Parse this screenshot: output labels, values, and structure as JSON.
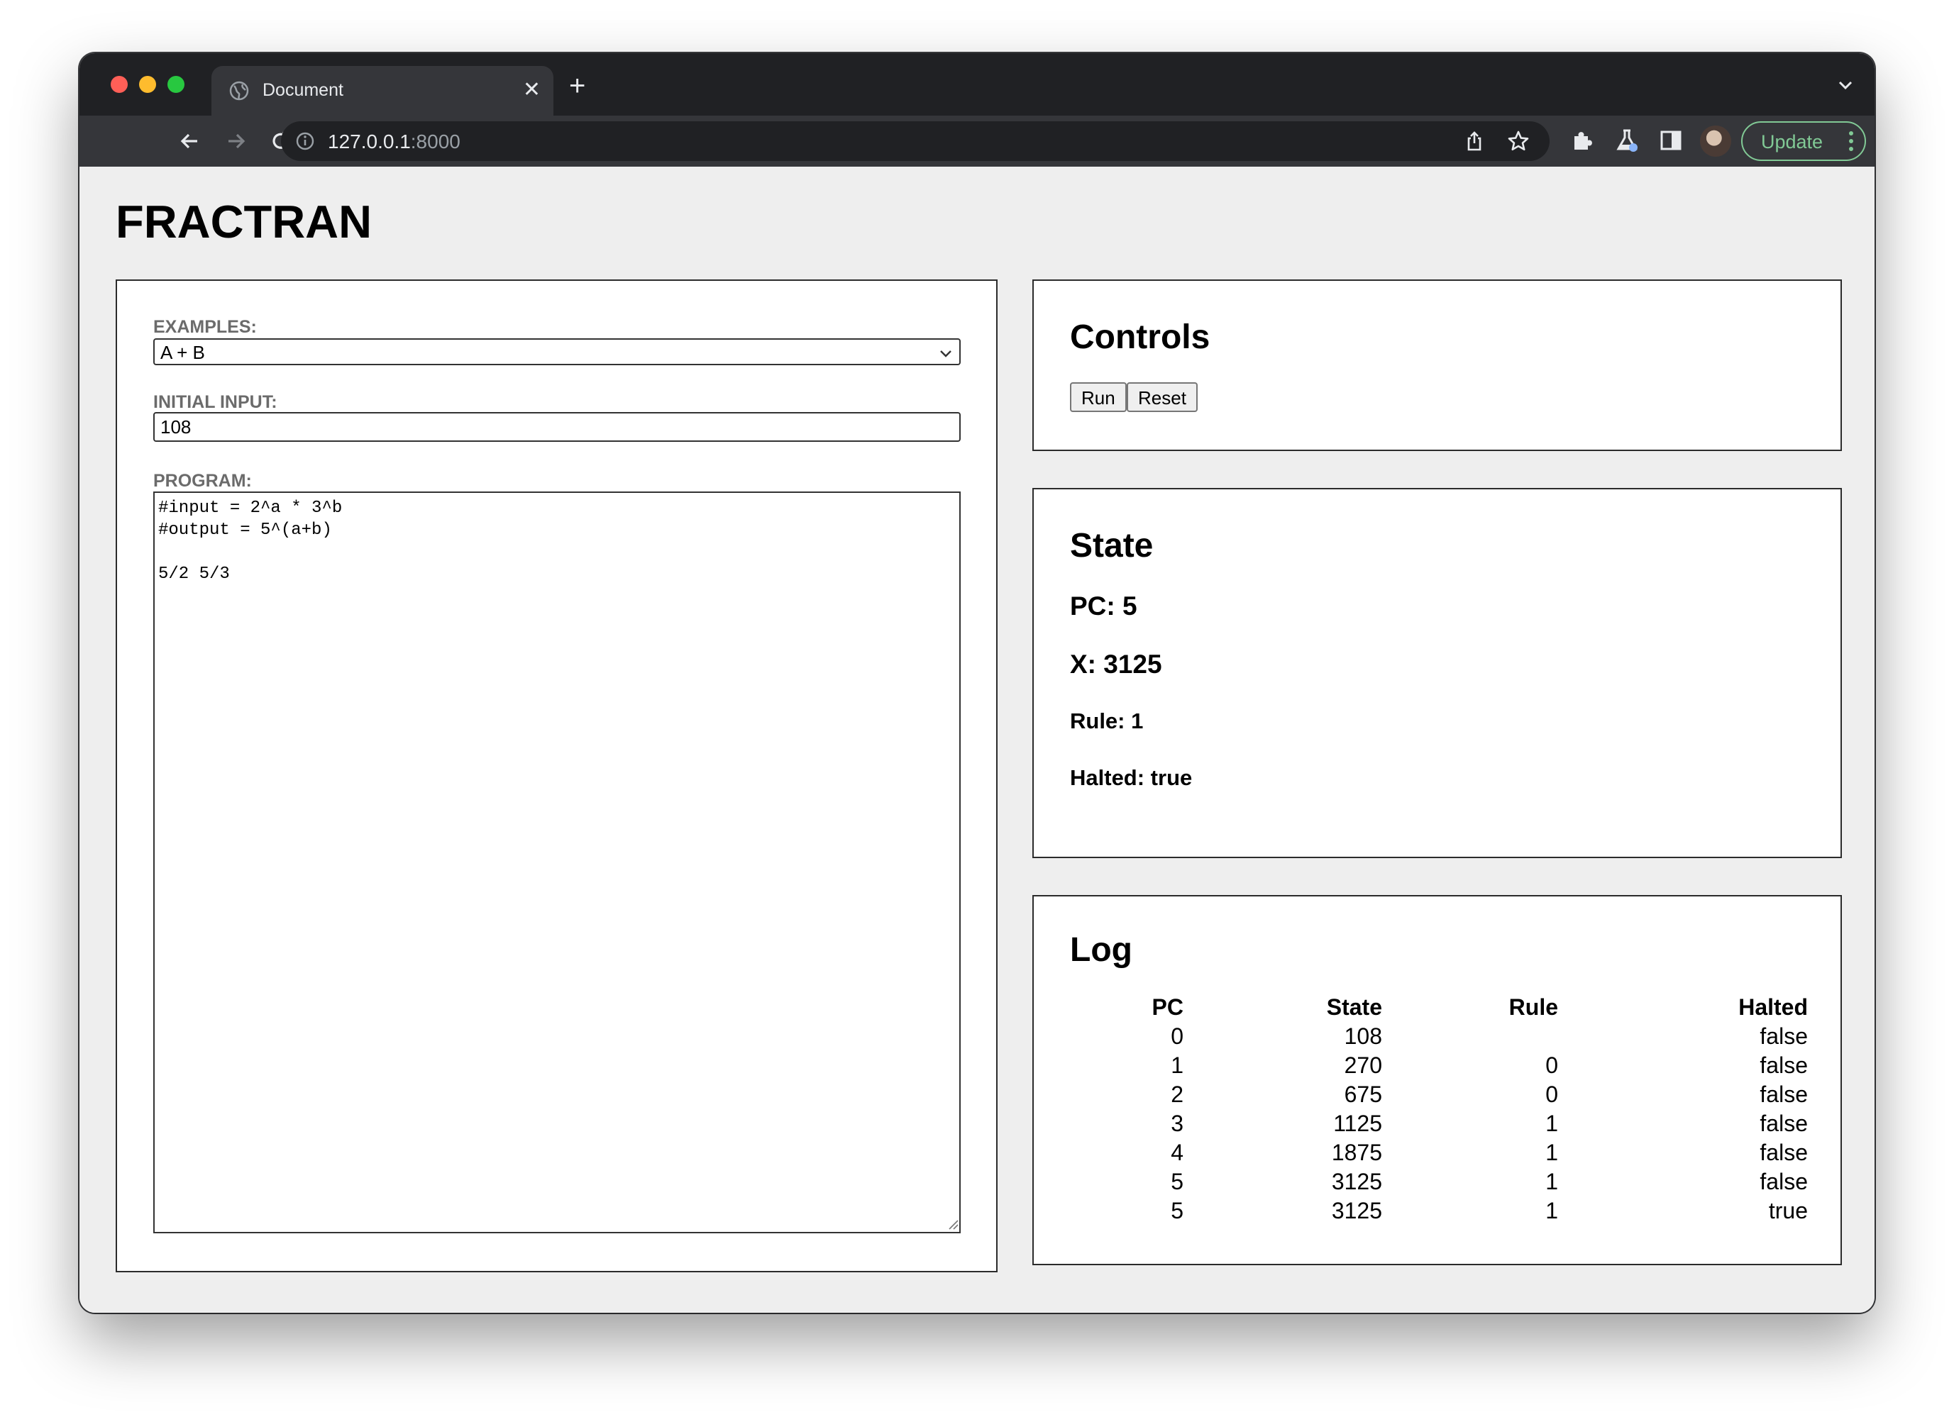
{
  "browser": {
    "tab_title": "Document",
    "tab_close": "✕",
    "new_tab": "+",
    "url_host": "127.0.0.1",
    "url_port": ":8000",
    "update_label": "Update"
  },
  "page": {
    "title": "FRACTRAN"
  },
  "config": {
    "examples_label": "EXAMPLES:",
    "example_selected": "A + B",
    "initial_input_label": "INITIAL INPUT:",
    "initial_input_value": "108",
    "program_label": "PROGRAM:",
    "program_text": "#input = 2^a * 3^b\n#output = 5^(a+b)\n\n5/2 5/3"
  },
  "controls": {
    "title": "Controls",
    "run_label": "Run",
    "reset_label": "Reset"
  },
  "state": {
    "title": "State",
    "pc": "PC: 5",
    "x": "X: 3125",
    "rule": "Rule: 1",
    "halted": "Halted: true"
  },
  "log": {
    "title": "Log",
    "headers": [
      "PC",
      "State",
      "Rule",
      "Halted"
    ],
    "rows": [
      [
        "0",
        "108",
        "",
        "false"
      ],
      [
        "1",
        "270",
        "0",
        "false"
      ],
      [
        "2",
        "675",
        "0",
        "false"
      ],
      [
        "3",
        "1125",
        "1",
        "false"
      ],
      [
        "4",
        "1875",
        "1",
        "false"
      ],
      [
        "5",
        "3125",
        "1",
        "false"
      ],
      [
        "5",
        "3125",
        "1",
        "true"
      ]
    ]
  }
}
